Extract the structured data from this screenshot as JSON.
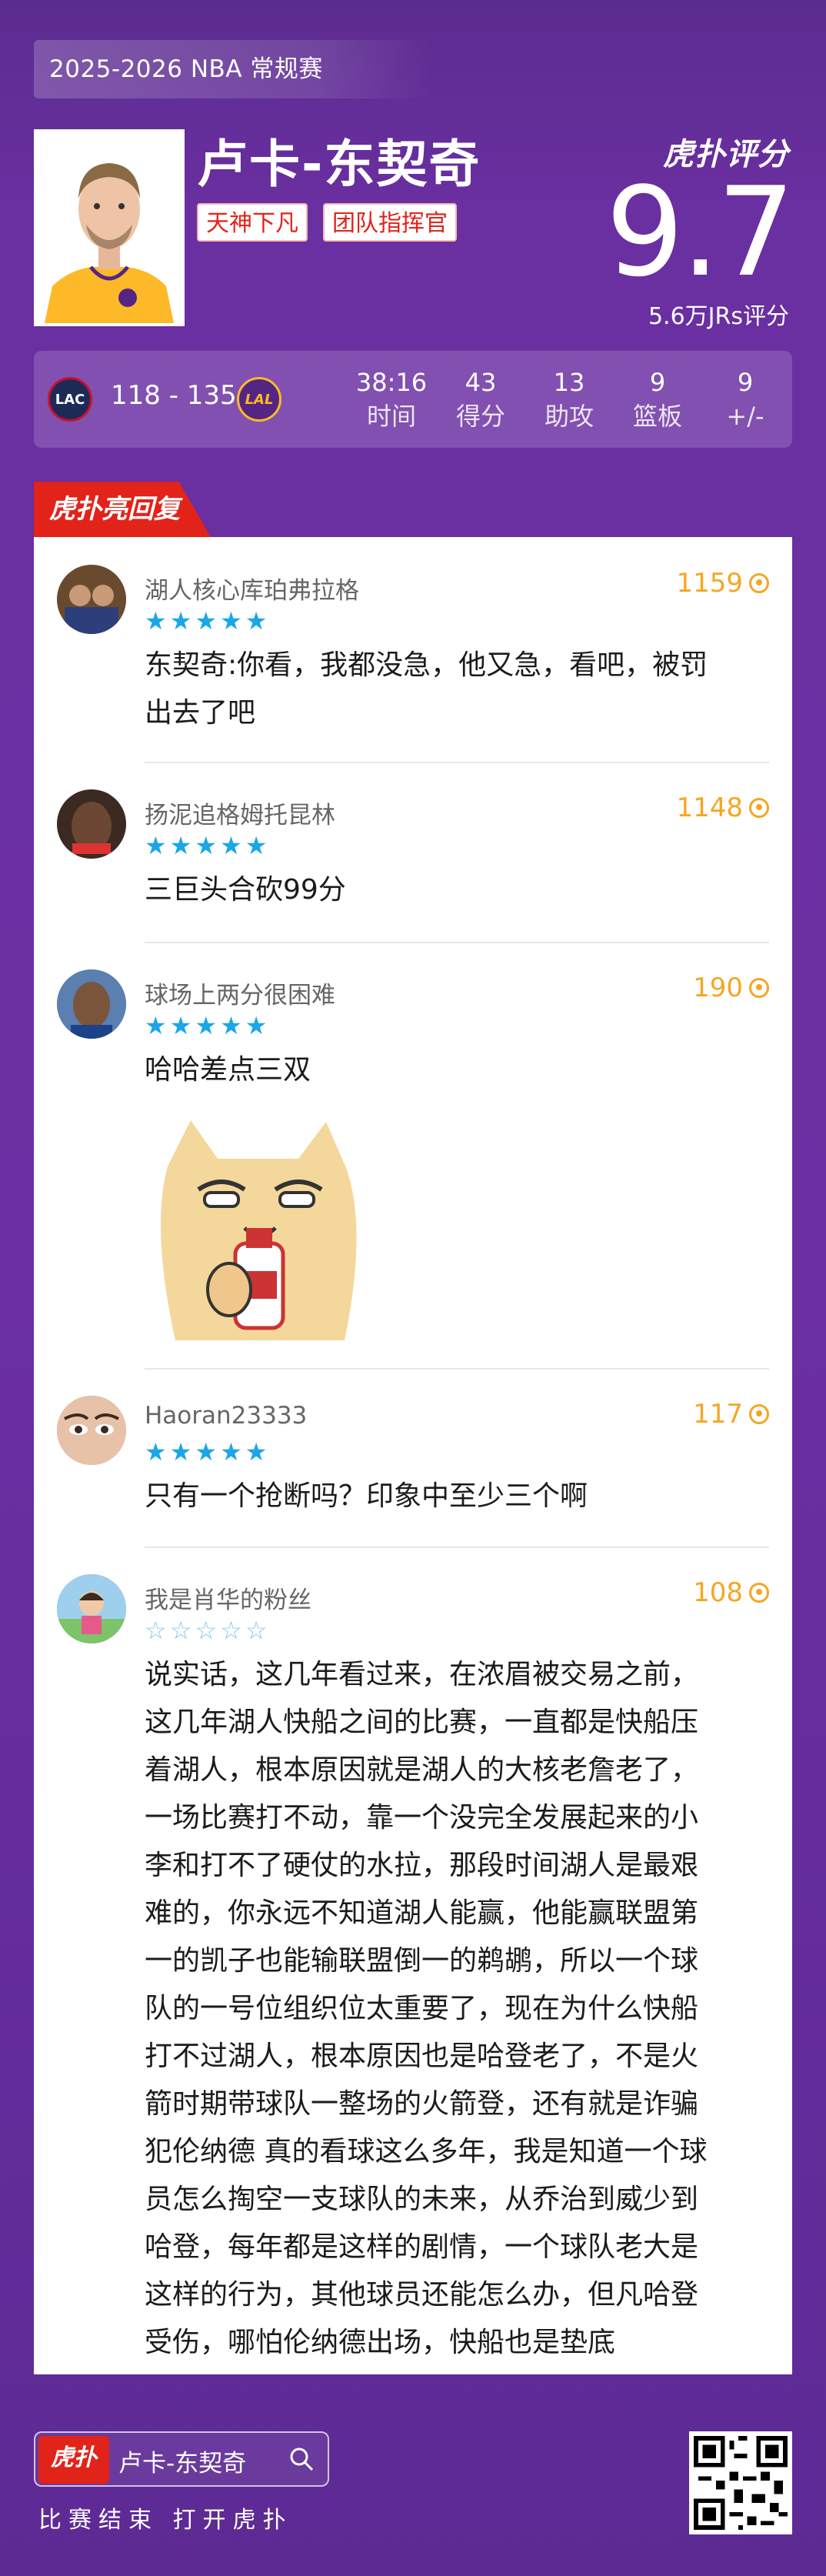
{
  "header": {
    "season": "2025-2026 NBA 常规赛",
    "player_name": "卢卡-东契奇",
    "tags": [
      "天神下凡",
      "团队指挥官"
    ],
    "brand": "虎扑评分",
    "score": "9.7",
    "score_sub": "5.6万JRs评分"
  },
  "game": {
    "away_team_icon": "clippers-logo-icon",
    "home_team_icon": "lakers-logo-icon",
    "away_abbr": "LAC",
    "home_abbr": "LAL",
    "score": "118 - 135",
    "stats": [
      {
        "value": "38:16",
        "label": "时间"
      },
      {
        "value": "43",
        "label": "得分"
      },
      {
        "value": "13",
        "label": "助攻"
      },
      {
        "value": "9",
        "label": "篮板"
      },
      {
        "value": "9",
        "label": "+/-"
      }
    ]
  },
  "section_title": "虎扑亮回复",
  "comments": [
    {
      "name": "湖人核心库珀弗拉格",
      "likes": "1159",
      "stars": 5,
      "text": [
        "东契奇:你看，我都没急，他又急，看吧，被罚",
        "出去了吧"
      ]
    },
    {
      "name": "扬泥追格姆托昆林",
      "likes": "1148",
      "stars": 5,
      "text": [
        "三巨头合砍99分"
      ]
    },
    {
      "name": "球场上两分很困难",
      "likes": "190",
      "stars": 5,
      "text": [
        "哈哈差点三双"
      ]
    },
    {
      "name": "Haoran23333",
      "likes": "117",
      "stars": 5,
      "text": [
        "只有一个抢断吗？印象中至少三个啊"
      ]
    },
    {
      "name": "我是肖华的粉丝",
      "likes": "108",
      "stars": 0,
      "text": [
        "说实话，这几年看过来，在浓眉被交易之前，",
        "这几年湖人快船之间的比赛，一直都是快船压",
        "着湖人，根本原因就是湖人的大核老詹老了，",
        "一场比赛打不动，靠一个没完全发展起来的小",
        "李和打不了硬仗的水拉，那段时间湖人是最艰",
        "难的，你永远不知道湖人能赢，他能赢联盟第",
        "一的凯子也能输联盟倒一的鹈鹕，所以一个球",
        "队的一号位组织位太重要了，现在为什么快船",
        "打不过湖人，根本原因也是哈登老了，不是火",
        "箭时期带球队一整场的火箭登，还有就是诈骗",
        "犯伦纳德 真的看球这么多年，我是知道一个球",
        "员怎么掏空一支球队的未来，从乔治到威少到",
        "哈登，每年都是这样的剧情，一个球队老大是",
        "这样的行为，其他球员还能怎么办，但凡哈登",
        "受伤，哪怕伦纳德出场，快船也是垫底"
      ]
    }
  ],
  "footer": {
    "logo": "虎扑",
    "search_text": "卢卡-东契奇",
    "caption": "比赛结束 打开虎扑"
  },
  "colors": {
    "purple": "#6b2fa3",
    "red": "#e2231a",
    "gold": "#f5a623",
    "blue_star": "#1aa6e8"
  }
}
